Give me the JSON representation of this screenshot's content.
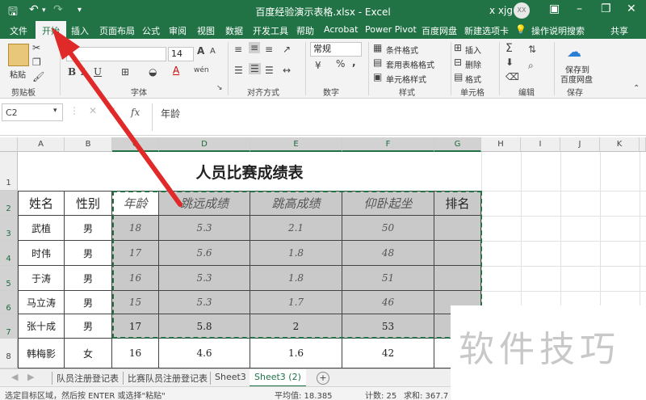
{
  "titlebar": {
    "title": "百度经验演示表格.xlsx  -  Excel",
    "user": "x xjg",
    "avatar": "XX",
    "save_icon": "save-icon",
    "undo_icon": "undo-icon",
    "redo_icon": "redo-icon"
  },
  "tabs": [
    "文件",
    "开始",
    "插入",
    "页面布局",
    "公式",
    "审阅",
    "视图",
    "数据",
    "开发工具",
    "帮助",
    "Acrobat",
    "Power Pivot",
    "百度网盘",
    "新建选项卡",
    "操作说明搜索"
  ],
  "active_tab": "开始",
  "share_label": "共享",
  "ribbon": {
    "clipboard": {
      "paste": "粘贴",
      "label": "剪贴板"
    },
    "font": {
      "name": "",
      "size": "14",
      "label": "字体",
      "bold": "B",
      "italic": "I",
      "underline": "U",
      "grow": "A",
      "shrink": "A",
      "fontcolor": "A",
      "phonetic": "wén"
    },
    "alignment": {
      "label": "对齐方式"
    },
    "number": {
      "format": "常规",
      "label": "数字",
      "percent": "%",
      "comma": ","
    },
    "styles": {
      "cond": "条件格式",
      "table": "套用表格格式",
      "cell": "单元格样式",
      "label": "样式"
    },
    "cells": {
      "insert": "插入",
      "delete": "删除",
      "format": "格式",
      "label": "单元格"
    },
    "editing": {
      "label": "编辑",
      "sum": "Σ"
    },
    "save": {
      "line1": "保存到",
      "line2": "百度网盘",
      "label": "保存"
    }
  },
  "namebox": "C2",
  "fx": "fx",
  "formula": "年龄",
  "columns": [
    "A",
    "B",
    "C",
    "D",
    "E",
    "F",
    "G",
    "H",
    "I",
    "J",
    "K"
  ],
  "rows": [
    "1",
    "2",
    "3",
    "4",
    "5",
    "6",
    "7",
    "8"
  ],
  "sheet": {
    "title": "人员比赛成绩表",
    "headers": [
      "姓名",
      "性别",
      "年龄",
      "跳远成绩",
      "跳高成绩",
      "仰卧起坐",
      "排名"
    ],
    "data": [
      [
        "武植",
        "男",
        "18",
        "5.3",
        "2.1",
        "50",
        ""
      ],
      [
        "时伟",
        "男",
        "17",
        "5.6",
        "1.8",
        "48",
        ""
      ],
      [
        "于涛",
        "男",
        "16",
        "5.3",
        "1.8",
        "51",
        ""
      ],
      [
        "马立涛",
        "男",
        "15",
        "5.3",
        "1.7",
        "46",
        ""
      ],
      [
        "张十成",
        "男",
        "17",
        "5.8",
        "2",
        "53",
        ""
      ],
      [
        "韩梅影",
        "女",
        "16",
        "4.6",
        "1.6",
        "42",
        ""
      ]
    ]
  },
  "sheet_tabs": [
    "队员注册登记表",
    "比赛队员注册登记表",
    "Sheet3",
    "Sheet3 (2)"
  ],
  "active_sheet": "Sheet3 (2)",
  "add_sheet": "+",
  "status": {
    "message": "选定目标区域，然后按 ENTER 或选择\"粘贴\"",
    "average": "平均值: 18.385",
    "count": "计数: 25",
    "sum": "求和: 367.7"
  },
  "watermark": "软件技巧",
  "colors": {
    "excel_green": "#217346",
    "selection_gray": "#c9c9c9",
    "arrow": "#e02a2a"
  }
}
